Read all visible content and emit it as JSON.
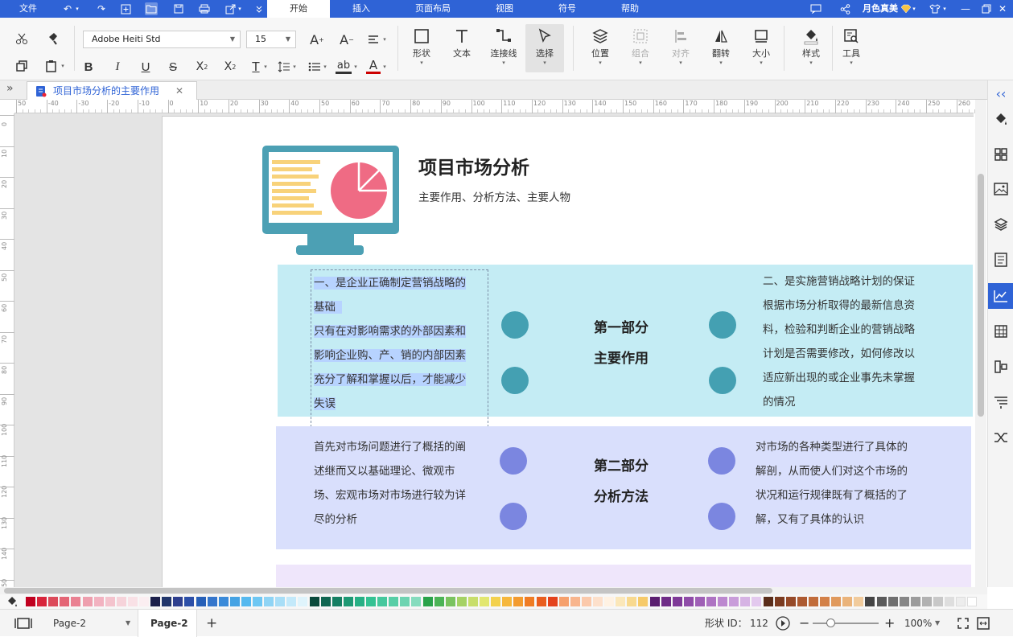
{
  "menubar": {
    "file": "文件",
    "tabs": [
      {
        "label": "开始",
        "active": true
      },
      {
        "label": "插入"
      },
      {
        "label": "页面布局"
      },
      {
        "label": "视图"
      },
      {
        "label": "符号"
      },
      {
        "label": "帮助"
      }
    ],
    "user_name": "月色真美"
  },
  "ribbon": {
    "font_family": "Adobe Heiti Std",
    "font_size": "15",
    "tools": [
      {
        "label": "形状",
        "icon": "square-icon"
      },
      {
        "label": "文本",
        "icon": "text-icon"
      },
      {
        "label": "连接线",
        "icon": "connector-icon"
      },
      {
        "label": "选择",
        "icon": "cursor-icon"
      }
    ],
    "arrange": [
      {
        "label": "位置",
        "icon": "layers-icon"
      },
      {
        "label": "组合",
        "icon": "group-icon"
      },
      {
        "label": "对齐",
        "icon": "align-icon"
      },
      {
        "label": "翻转",
        "icon": "flip-icon"
      },
      {
        "label": "大小",
        "icon": "size-icon"
      }
    ],
    "style_label": "样式",
    "tools_label": "工具"
  },
  "document_tab": {
    "title": "项目市场分析的主要作用"
  },
  "ruler": {
    "h_ticks": [
      "50",
      "-40",
      "-30",
      "-20",
      "-10",
      "0",
      "10",
      "20",
      "30",
      "40",
      "50",
      "60",
      "70",
      "80",
      "90",
      "100",
      "110",
      "120",
      "130",
      "140",
      "150",
      "160",
      "170",
      "180",
      "190",
      "200",
      "210",
      "220",
      "230",
      "240",
      "250",
      "260"
    ],
    "v_ticks": [
      "0",
      "10",
      "20",
      "30",
      "40",
      "50",
      "60",
      "70",
      "80",
      "90",
      "100",
      "110",
      "120",
      "130",
      "140",
      "150"
    ]
  },
  "content": {
    "title": "项目市场分析",
    "subtitle": "主要作用、分析方法、主要人物",
    "section1": {
      "label_line1": "第一部分",
      "label_line2": "主要作用",
      "left_heading_line1": "一、是企业正确制定营销战略的",
      "left_heading_line2": "基础",
      "left_line1": "只有在对影响需求的外部因素和",
      "left_line2": "影响企业购、产、销的内部因素",
      "left_line3": "充分了解和掌握以后，才能减少",
      "left_line4": "失误",
      "right_line1": "二、是实施营销战略计划的保证",
      "right_line2": "根据市场分析取得的最新信息资",
      "right_line3": "料，检验和判断企业的营销战略",
      "right_line4": "计划是否需要修改，如何修改以",
      "right_line5": "适应新出现的或企业事先未掌握",
      "right_line6": "的情况"
    },
    "section2": {
      "label_line1": "第二部分",
      "label_line2": "分析方法",
      "left_line1": "首先对市场问题进行了概括的阐",
      "left_line2": "述继而又以基础理论、微观市",
      "left_line3": "场、宏观市场对市场进行较为详",
      "left_line4": "尽的分析",
      "right_line1": "对市场的各种类型进行了具体的",
      "right_line2": "解剖，从而使人们对这个市场的",
      "right_line3": "状况和运行规律既有了概括的了",
      "right_line4": "解，又有了具体的认识"
    }
  },
  "colors": {
    "accent": "#2f63d6",
    "band1": "#c4ecf4",
    "band2": "#d9dffc",
    "band3": "#efe6fb",
    "circle1": "#44a0b2",
    "circle2": "#7b86e0",
    "monitor": "#4ca0b4",
    "pie": "#ef6b84",
    "bars": "#f8d27a"
  },
  "status": {
    "page_selector": "Page-2",
    "page_tab": "Page-2",
    "shape_id_label": "形状 ID：",
    "shape_id": "112",
    "zoom": "100%"
  }
}
